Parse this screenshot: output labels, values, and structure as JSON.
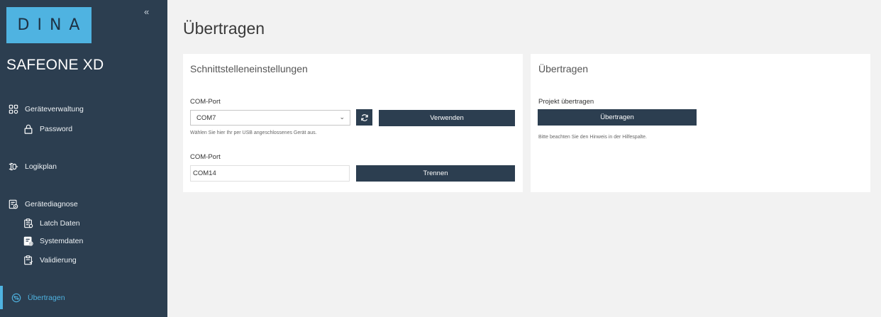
{
  "sidebar": {
    "collapse_glyph": "«",
    "logo_text": "DINA",
    "product_name": "SAFEONE XD",
    "items": [
      {
        "label": "Geräteverwaltung",
        "icon": "devices-icon"
      },
      {
        "label": "Password",
        "icon": "lock-icon"
      },
      {
        "label": "Logikplan",
        "icon": "logic-plan-icon"
      },
      {
        "label": "Gerätediagnose",
        "icon": "diagnosis-icon"
      },
      {
        "label": "Latch Daten",
        "icon": "clipboard-icon"
      },
      {
        "label": "Systemdaten",
        "icon": "system-data-icon"
      },
      {
        "label": "Validierung",
        "icon": "clipboard-check-icon"
      },
      {
        "label": "Übertragen",
        "icon": "transfer-icon",
        "active": true
      }
    ],
    "colors": {
      "background": "#2c3e50",
      "accent": "#4fb3e1"
    }
  },
  "main": {
    "title": "Übertragen",
    "interface_card": {
      "title": "Schnittstelleneinstellungen",
      "com_port_label": "COM-Port",
      "com_port_value": "COM7",
      "use_button": "Verwenden",
      "hint": "Wählen Sie hier Ihr per USB angeschlossenes Gerät aus.",
      "connected_label": "COM-Port",
      "connected_value": "COM14",
      "disconnect_button": "Trennen"
    },
    "transfer_card": {
      "title": "Übertragen",
      "project_label": "Projekt übertragen",
      "transfer_button": "Übertragen",
      "hint": "Bitte beachten Sie den Hinweis in der Hilfespalte."
    }
  }
}
